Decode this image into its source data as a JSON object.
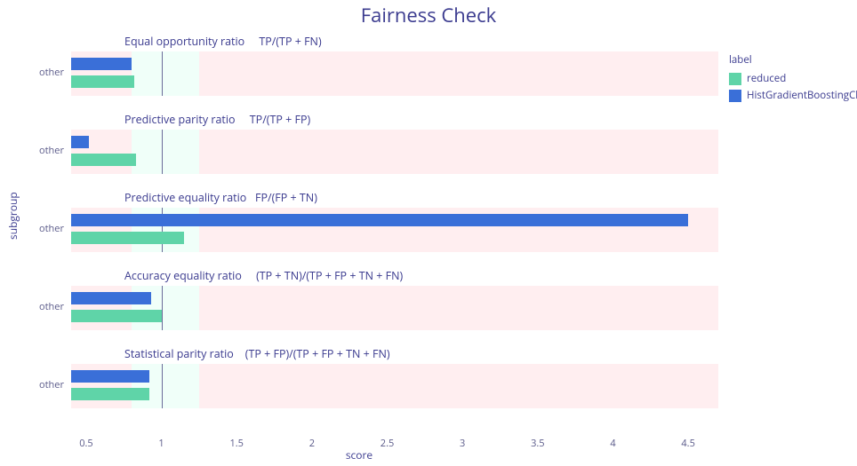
{
  "title": "Fairness Check",
  "xlabel": "score",
  "ylabel": "subgroup",
  "category_label": "other",
  "legend": {
    "title": "label",
    "items": [
      {
        "key": "reduced",
        "label": "reduced",
        "color": "#5fd4a8"
      },
      {
        "key": "hgbc",
        "label": "HistGradientBoostingClassifier",
        "color": "#3a6fd8"
      }
    ]
  },
  "axis": {
    "xmin": 0.4,
    "xmax": 4.7,
    "ticks": [
      0.5,
      1,
      1.5,
      2,
      2.5,
      3,
      3.5,
      4,
      4.5
    ],
    "fair_band": [
      0.8,
      1.25
    ]
  },
  "chart_data": [
    {
      "type": "bar",
      "title": "Equal opportunity ratio     TP/(TP + FN)",
      "categories": [
        "other"
      ],
      "series": [
        {
          "name": "HistGradientBoostingClassifier",
          "values": [
            0.8
          ]
        },
        {
          "name": "reduced",
          "values": [
            0.82
          ]
        }
      ],
      "xlabel": "score",
      "ylabel": "subgroup"
    },
    {
      "type": "bar",
      "title": "Predictive parity ratio     TP/(TP + FP)",
      "categories": [
        "other"
      ],
      "series": [
        {
          "name": "HistGradientBoostingClassifier",
          "values": [
            0.52
          ]
        },
        {
          "name": "reduced",
          "values": [
            0.83
          ]
        }
      ],
      "xlabel": "score",
      "ylabel": "subgroup"
    },
    {
      "type": "bar",
      "title": "Predictive equality ratio   FP/(FP + TN)",
      "categories": [
        "other"
      ],
      "series": [
        {
          "name": "HistGradientBoostingClassifier",
          "values": [
            4.5
          ]
        },
        {
          "name": "reduced",
          "values": [
            1.15
          ]
        }
      ],
      "xlabel": "score",
      "ylabel": "subgroup"
    },
    {
      "type": "bar",
      "title": "Accuracy equality ratio     (TP + TN)/(TP + FP + TN + FN)",
      "categories": [
        "other"
      ],
      "series": [
        {
          "name": "HistGradientBoostingClassifier",
          "values": [
            0.93
          ]
        },
        {
          "name": "reduced",
          "values": [
            1.0
          ]
        }
      ],
      "xlabel": "score",
      "ylabel": "subgroup"
    },
    {
      "type": "bar",
      "title": "Statistical parity ratio    (TP + FP)/(TP + FP + TN + FN)",
      "categories": [
        "other"
      ],
      "series": [
        {
          "name": "HistGradientBoostingClassifier",
          "values": [
            0.92
          ]
        },
        {
          "name": "reduced",
          "values": [
            0.92
          ]
        }
      ],
      "xlabel": "score",
      "ylabel": "subgroup"
    }
  ]
}
